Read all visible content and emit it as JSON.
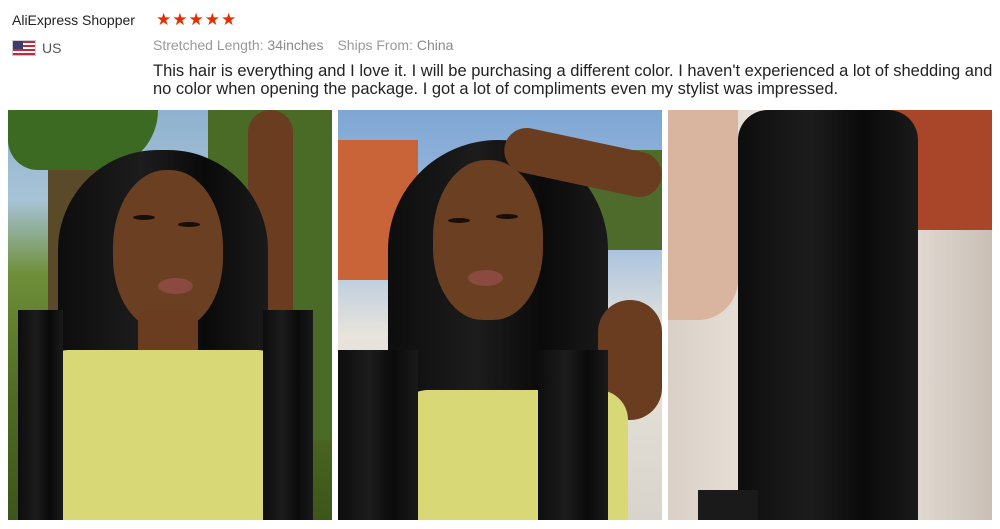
{
  "review": {
    "shopper_name": "AliExpress Shopper",
    "stars": "★★★★★",
    "rating": 5,
    "country": "US",
    "stretched_length_label": "Stretched Length:",
    "stretched_length_value": "34inches",
    "ships_from_label": "Ships From:",
    "ships_from_value": "China",
    "text": "This hair is everything and I love it. I will be purchasing a different color. I haven't experienced a lot of shedding and no color when opening the package. I got a lot of compliments even my stylist was impressed."
  },
  "colors": {
    "star": "#e62e04",
    "text": "#222222",
    "meta": "#888888"
  },
  "icons": [
    "us-flag-icon",
    "star-icon"
  ]
}
